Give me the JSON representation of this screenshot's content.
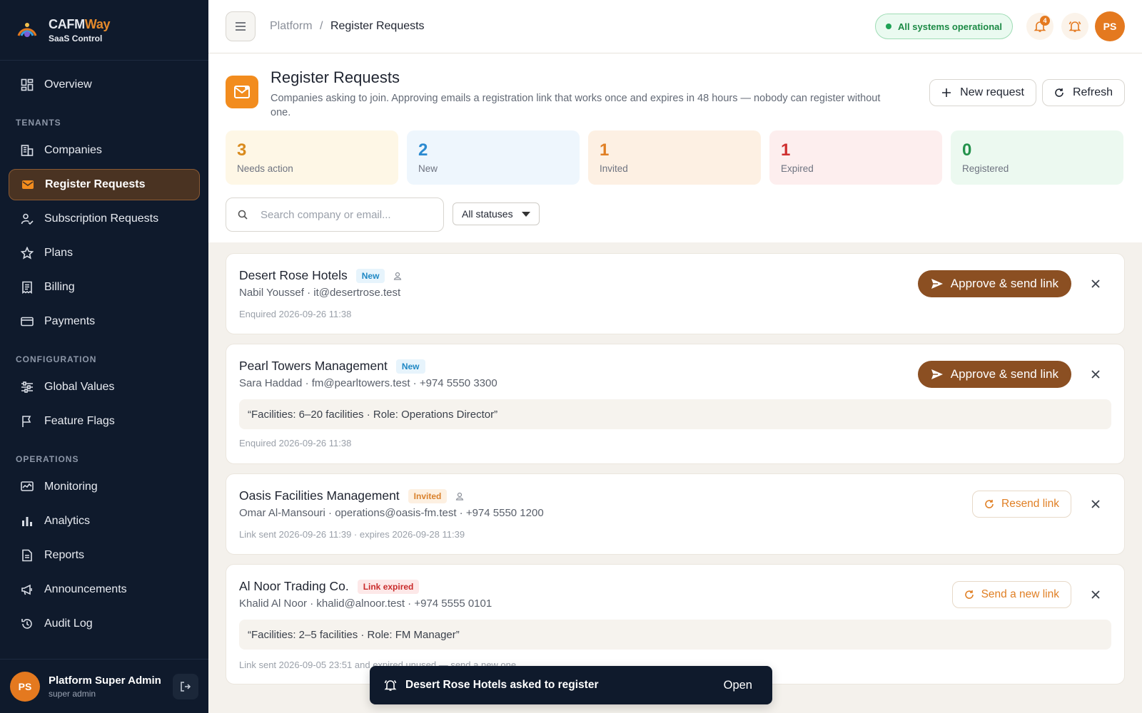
{
  "brand": {
    "name_main": "CAFM",
    "name_accent": "Way",
    "subtitle": "SaaS Control"
  },
  "sidebar": {
    "top_items": [
      {
        "label": "Overview",
        "icon": "grid-icon"
      }
    ],
    "sections": [
      {
        "title": "TENANTS",
        "items": [
          {
            "label": "Companies",
            "icon": "building-icon"
          },
          {
            "label": "Register Requests",
            "icon": "mail-icon",
            "active": true
          },
          {
            "label": "Subscription Requests",
            "icon": "user-check-icon"
          },
          {
            "label": "Plans",
            "icon": "star-icon"
          },
          {
            "label": "Billing",
            "icon": "receipt-icon"
          },
          {
            "label": "Payments",
            "icon": "card-icon"
          }
        ]
      },
      {
        "title": "CONFIGURATION",
        "items": [
          {
            "label": "Global Values",
            "icon": "sliders-icon"
          },
          {
            "label": "Feature Flags",
            "icon": "flag-icon"
          }
        ]
      },
      {
        "title": "OPERATIONS",
        "items": [
          {
            "label": "Monitoring",
            "icon": "monitor-icon"
          },
          {
            "label": "Analytics",
            "icon": "bar-chart-icon"
          },
          {
            "label": "Reports",
            "icon": "report-icon"
          },
          {
            "label": "Announcements",
            "icon": "megaphone-icon"
          },
          {
            "label": "Audit Log",
            "icon": "history-icon"
          }
        ]
      }
    ],
    "user": {
      "initials": "PS",
      "name": "Platform Super Admin",
      "role": "super admin"
    }
  },
  "topbar": {
    "breadcrumb_root": "Platform",
    "breadcrumb_sep": "/",
    "breadcrumb_current": "Register Requests",
    "status": "All systems operational",
    "notification_count": "4",
    "avatar_initials": "PS"
  },
  "page": {
    "title": "Register Requests",
    "description": "Companies asking to join. Approving emails a registration link that works once and expires in 48 hours — nobody can register without one.",
    "new_request_label": "New request",
    "refresh_label": "Refresh",
    "search_placeholder": "Search company or email...",
    "status_filter": "All statuses"
  },
  "stats": [
    {
      "value": "3",
      "label": "Needs action",
      "color": "#d98b1e",
      "bg": "#fef7e6"
    },
    {
      "value": "2",
      "label": "New",
      "color": "#2b8ad0",
      "bg": "#eef6fd"
    },
    {
      "value": "1",
      "label": "Invited",
      "color": "#e07f24",
      "bg": "#fdf0e3"
    },
    {
      "value": "1",
      "label": "Expired",
      "color": "#cf2f2f",
      "bg": "#fdeeee"
    },
    {
      "value": "0",
      "label": "Registered",
      "color": "#24924c",
      "bg": "#ecf9f0"
    }
  ],
  "requests": [
    {
      "company": "Desert Rose Hotels",
      "status": "New",
      "contact": "Nabil Youssef · it@desertrose.test",
      "meta": "Enquired 2026-09-26 11:38",
      "action": "Approve & send link"
    },
    {
      "company": "Pearl Towers Management",
      "status": "New",
      "contact": "Sara Haddad · fm@pearltowers.test · +974 5550 3300",
      "quote": "“Facilities: 6–20 facilities · Role: Operations Director”",
      "meta": "Enquired 2026-09-26 11:38",
      "action": "Approve & send link"
    },
    {
      "company": "Oasis Facilities Management",
      "status": "Invited",
      "contact": "Omar Al-Mansouri · operations@oasis-fm.test · +974 5550 1200",
      "meta": "Link sent 2026-09-26 11:39 · expires 2026-09-28 11:39",
      "action": "Resend link"
    },
    {
      "company": "Al Noor Trading Co.",
      "status": "Link expired",
      "contact": "Khalid Al Noor · khalid@alnoor.test · +974 5555 0101",
      "quote": "“Facilities: 2–5 facilities · Role: FM Manager”",
      "meta": "Link sent 2026-09-05 23:51 and expired unused — send a new one.",
      "action": "Send a new link"
    }
  ],
  "toast": {
    "message": "Desert Rose Hotels asked to register",
    "action": "Open"
  },
  "colors": {
    "accent": "#e4791f",
    "sidebar_bg": "#0f1a2c",
    "approve_bg": "#8b4f22"
  }
}
